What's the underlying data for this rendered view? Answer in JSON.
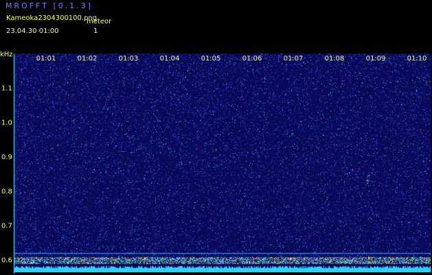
{
  "header": {
    "title": "MROFFT [0.1.3]",
    "file_name": "Kameoka2304300100.png",
    "meteor_label": "meteor",
    "timestamp": "23.04.30 01:00",
    "meteor_count": "1"
  },
  "freq_axis": {
    "unit": "kHz",
    "ticks": [
      {
        "label": "1.1",
        "value": 1.1
      },
      {
        "label": "1.0",
        "value": 1.0
      },
      {
        "label": "0.9",
        "value": 0.9
      },
      {
        "label": "0.8",
        "value": 0.8
      },
      {
        "label": "0.7",
        "value": 0.7
      },
      {
        "label": "0.6",
        "value": 0.6
      }
    ]
  },
  "time_axis": {
    "ticks": [
      "01:01",
      "01:02",
      "01:03",
      "01:04",
      "01:05",
      "01:06",
      "01:07",
      "01:08",
      "01:09",
      "01:10"
    ]
  },
  "colors": {
    "background": "#000000",
    "header_title": "#7a7cff",
    "text": "#ffff55",
    "plot_bg": "#0a0a5a",
    "noise_speck": "#3a6cff",
    "axis": "#2ad0ff"
  }
}
